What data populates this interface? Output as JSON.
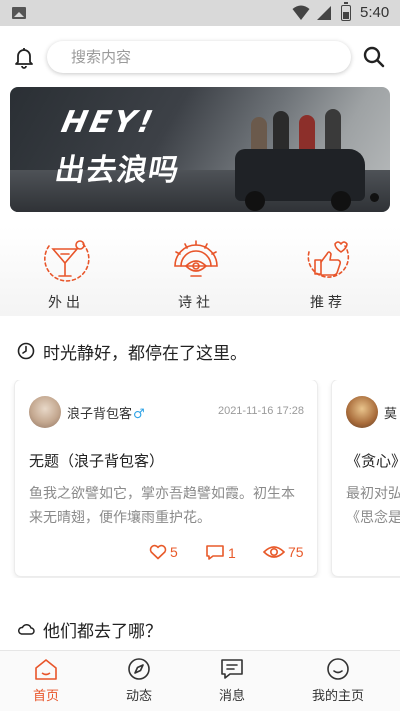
{
  "status_bar": {
    "time": "5:40"
  },
  "search": {
    "placeholder": "搜索内容"
  },
  "banner": {
    "headline": "HEY!",
    "subheadline": "出去浪吗"
  },
  "quick_nav": [
    {
      "label": "外出",
      "icon": "cocktail-icon"
    },
    {
      "label": "诗社",
      "icon": "fan-eye-icon"
    },
    {
      "label": "推荐",
      "icon": "heart-thumbs-up-icon"
    }
  ],
  "section_posts": {
    "title": "时光静好，都停在了这里。",
    "icon": "clock-icon"
  },
  "posts": [
    {
      "author": "浪子背包客",
      "gender_symbol": "♂",
      "date": "2021-11-16 17:28",
      "title": "无题（浪子背包客）",
      "excerpt": "鱼我之欲譬如它，掌亦吾趋譬如霞。初生本来无晴翅，便作壤雨重护花。",
      "likes": "5",
      "comments": "1",
      "views": "75"
    },
    {
      "author": "莫",
      "title": "《贪心》",
      "excerpt": "最初对弘《思念是"
    }
  ],
  "section_places": {
    "title": "他们都去了哪？",
    "icon": "cloud-icon"
  },
  "bottom_nav": [
    {
      "label": "首页",
      "icon": "home-icon",
      "active": true
    },
    {
      "label": "动态",
      "icon": "compass-icon"
    },
    {
      "label": "消息",
      "icon": "message-icon"
    },
    {
      "label": "我的主页",
      "icon": "smile-icon"
    }
  ],
  "colors": {
    "accent": "#E8552A",
    "gender": "#2FA3E6"
  }
}
